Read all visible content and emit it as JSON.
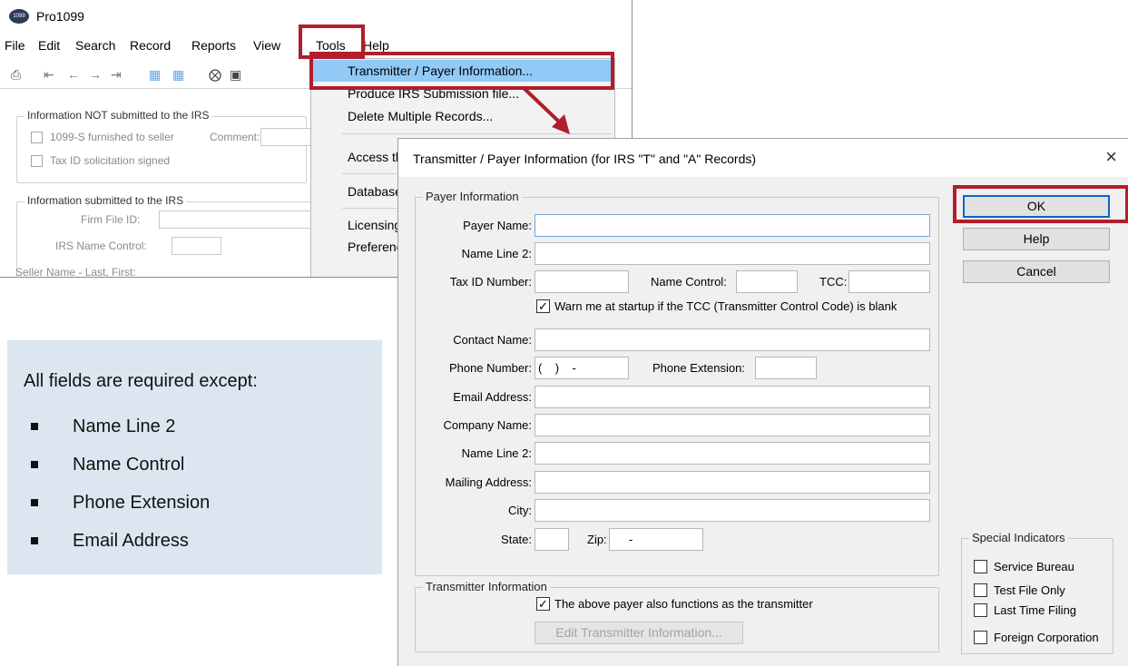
{
  "app": {
    "title": "Pro1099",
    "logo_text": "1099",
    "menu": [
      "File",
      "Edit",
      "Search",
      "Record",
      "Reports",
      "View",
      "Tools",
      "Help"
    ],
    "not_submitted": {
      "legend": "Information NOT submitted to the IRS",
      "furnished_label": "1099-S furnished to seller",
      "comment_label": "Comment:",
      "tax_id_label": "Tax ID solicitation signed"
    },
    "submitted": {
      "legend": "Information submitted to the IRS",
      "firm_file_label": "Firm File ID:",
      "irs_name_control_label": "IRS Name Control:",
      "seller_name_label": "Seller Name - Last, First:"
    }
  },
  "tools_menu": {
    "items": [
      "Transmitter / Payer Information...",
      "Produce IRS Submission file...",
      "Delete Multiple Records...",
      "Access th",
      "Database",
      "Licensing",
      "Preferenc"
    ]
  },
  "callout": {
    "heading": "All fields are required except:",
    "items": [
      "Name Line 2",
      "Name Control",
      "Phone Extension",
      "Email Address"
    ]
  },
  "dialog": {
    "title": "Transmitter / Payer Information (for IRS \"T\" and \"A\" Records)",
    "close_glyph": "×",
    "payer_legend": "Payer Information",
    "labels": {
      "payer_name": "Payer Name:",
      "name_line2": "Name Line 2:",
      "tax_id": "Tax ID Number:",
      "name_control": "Name Control:",
      "tcc": "TCC:",
      "contact_name": "Contact Name:",
      "phone_number": "Phone Number:",
      "phone_extension": "Phone Extension:",
      "email": "Email Address:",
      "company_name": "Company Name:",
      "company_name_line2": "Name Line 2:",
      "mailing_address": "Mailing Address:",
      "city": "City:",
      "state": "State:",
      "zip": "Zip:"
    },
    "values": {
      "payer_name": "",
      "name_line2": "",
      "tax_id": "",
      "name_control": "",
      "tcc": "",
      "contact_name": "",
      "phone_number": "(    )    -",
      "phone_extension": "",
      "email": "",
      "company_name": "",
      "company_name_line2": "",
      "mailing_address": "",
      "city": "",
      "state": "",
      "zip": "     -"
    },
    "warn_checkbox": {
      "checked": true,
      "label": "Warn me at startup if the TCC (Transmitter Control Code) is blank"
    },
    "transmitter_legend": "Transmitter Information",
    "transmitter_checkbox": {
      "checked": true,
      "label": "The above payer also functions as the transmitter"
    },
    "edit_transmitter_button": "Edit Transmitter Information...",
    "buttons": {
      "ok": "OK",
      "help": "Help",
      "cancel": "Cancel"
    },
    "special": {
      "legend": "Special Indicators",
      "items": [
        "Service Bureau",
        "Test File Only",
        "Last Time Filing",
        "Foreign Corporation"
      ]
    },
    "check_glyph": "✓"
  },
  "colors": {
    "highlight_red": "#b01e2b",
    "menu_highlight": "#91c9f7",
    "callout_bg": "#dce6f0",
    "dialog_bg": "#f0f0f0"
  }
}
